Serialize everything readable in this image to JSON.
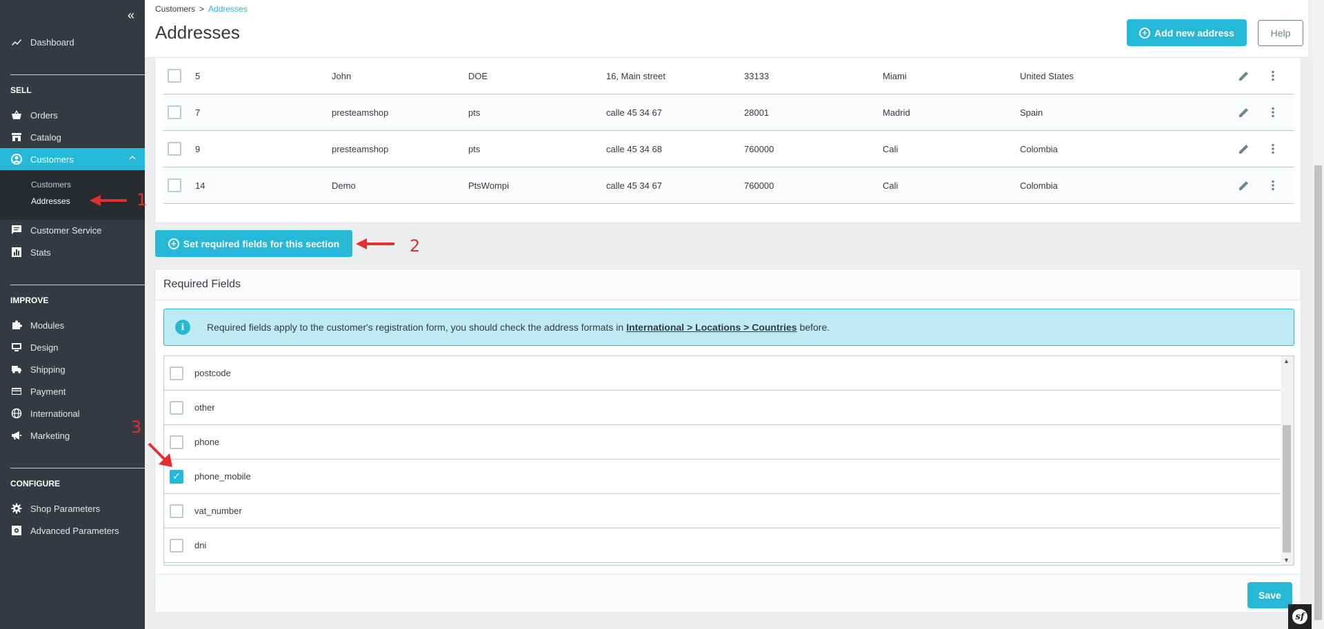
{
  "sidebar": {
    "collapse_glyph": "«",
    "items": {
      "dashboard": "Dashboard",
      "sell_title": "SELL",
      "orders": "Orders",
      "catalog": "Catalog",
      "customers": "Customers",
      "customers_sub": "Customers",
      "addresses_sub": "Addresses",
      "customer_service": "Customer Service",
      "stats": "Stats",
      "improve_title": "IMPROVE",
      "modules": "Modules",
      "design": "Design",
      "shipping": "Shipping",
      "payment": "Payment",
      "international": "International",
      "marketing": "Marketing",
      "configure_title": "CONFIGURE",
      "shop_parameters": "Shop Parameters",
      "advanced_parameters": "Advanced Parameters"
    }
  },
  "header": {
    "breadcrumb_parent": "Customers",
    "breadcrumb_sep": ">",
    "breadcrumb_current": "Addresses",
    "title": "Addresses",
    "add_button": "Add new address",
    "help_button": "Help"
  },
  "table": {
    "rows": [
      {
        "id": "5",
        "first": "John",
        "last": "DOE",
        "address": "16, Main street",
        "postcode": "33133",
        "city": "Miami",
        "country": "United States"
      },
      {
        "id": "7",
        "first": "presteamshop",
        "last": "pts",
        "address": "calle 45 34 67",
        "postcode": "28001",
        "city": "Madrid",
        "country": "Spain"
      },
      {
        "id": "9",
        "first": "presteamshop",
        "last": "pts",
        "address": "calle 45 34 68",
        "postcode": "760000",
        "city": "Cali",
        "country": "Colombia"
      },
      {
        "id": "14",
        "first": "Demo",
        "last": "PtsWompi",
        "address": "calle 45 34 67",
        "postcode": "760000",
        "city": "Cali",
        "country": "Colombia"
      }
    ]
  },
  "required_button": "Set required fields for this section",
  "required": {
    "title": "Required Fields",
    "alert_text": "Required fields apply to the customer's registration form, you should check the address formats in",
    "alert_link": "International > Locations > Countries",
    "alert_after": "before.",
    "fields": [
      {
        "name": "postcode",
        "checked": false
      },
      {
        "name": "other",
        "checked": false
      },
      {
        "name": "phone",
        "checked": false
      },
      {
        "name": "phone_mobile",
        "checked": true
      },
      {
        "name": "vat_number",
        "checked": false
      },
      {
        "name": "dni",
        "checked": false
      }
    ],
    "save_button": "Save"
  },
  "annotations": {
    "one": "1",
    "two": "2",
    "three": "3"
  },
  "colors": {
    "accent": "#25b9d7",
    "sidebar": "#363a41",
    "annotation": "#e03030"
  }
}
